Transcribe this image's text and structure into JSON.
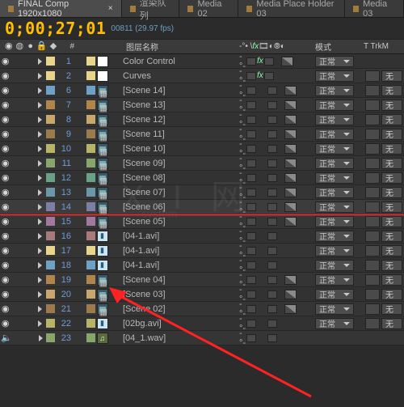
{
  "tabs": [
    {
      "label": "FINAL Comp 1920x1080",
      "active": true
    },
    {
      "label": "渲染队列"
    },
    {
      "label": "Media 02"
    },
    {
      "label": "Media Place Holder 03"
    },
    {
      "label": "Media 03"
    }
  ],
  "timecode": "0;00;27;01",
  "timecode_sub": "00811 (29.97 fps)",
  "headers": {
    "num": "#",
    "name": "图层名称",
    "sw": "⁄ fx",
    "mode": "模式",
    "trk": "T  TrkM"
  },
  "mode_normal": "正常",
  "none": "无",
  "colors": {
    "p1": "#e9d48c",
    "p2": "#6fa1c6",
    "p3": "#b0854c",
    "p4": "#c8a76c",
    "p5": "#9d7a4e",
    "p6": "#b7b367",
    "p7": "#87a66c",
    "p8": "#6aa087",
    "p9": "#6b97a8",
    "p10": "#7c7fa3",
    "p11": "#a2799e",
    "p12": "#a87a7a"
  },
  "layers": [
    {
      "n": 1,
      "sw": "p1",
      "type": "solid",
      "name": "Color Control",
      "fx": true,
      "half": true,
      "mode": true
    },
    {
      "n": 2,
      "sw": "p1",
      "type": "solid",
      "name": "Curves",
      "fx": true,
      "half": false,
      "mode": true,
      "none": true
    },
    {
      "n": 6,
      "sw": "p2",
      "type": "comp",
      "name": "[Scene 14]",
      "half": true,
      "mode": true,
      "none": true
    },
    {
      "n": 7,
      "sw": "p3",
      "type": "comp",
      "name": "[Scene 13]",
      "half": true,
      "mode": true,
      "none": true
    },
    {
      "n": 8,
      "sw": "p4",
      "type": "comp",
      "name": "[Scene 12]",
      "half": true,
      "mode": true,
      "none": true
    },
    {
      "n": 9,
      "sw": "p5",
      "type": "comp",
      "name": "[Scene 11]",
      "half": true,
      "mode": true,
      "none": true
    },
    {
      "n": 10,
      "sw": "p6",
      "type": "comp",
      "name": "[Scene 10]",
      "half": true,
      "mode": true,
      "none": true
    },
    {
      "n": 11,
      "sw": "p7",
      "type": "comp",
      "name": "[Scene 09]",
      "half": true,
      "mode": true,
      "none": true
    },
    {
      "n": 12,
      "sw": "p8",
      "type": "comp",
      "name": "[Scene 08]",
      "half": true,
      "mode": true,
      "none": true
    },
    {
      "n": 13,
      "sw": "p9",
      "type": "comp",
      "name": "[Scene 07]",
      "half": true,
      "mode": true,
      "none": true
    },
    {
      "n": 14,
      "sw": "p10",
      "type": "comp",
      "name": "[Scene 06]",
      "half": true,
      "mode": true,
      "none": true,
      "hl": true
    },
    {
      "n": 15,
      "sw": "p11",
      "type": "comp",
      "name": "[Scene 05]",
      "half": true,
      "mode": true,
      "none": true
    },
    {
      "n": 16,
      "sw": "p12",
      "type": "video",
      "name": "[04-1.avi]",
      "half": false,
      "mode": true,
      "none": true
    },
    {
      "n": 17,
      "sw": "p1",
      "type": "video",
      "name": "[04-1.avi]",
      "half": false,
      "mode": true,
      "none": true
    },
    {
      "n": 18,
      "sw": "p2",
      "type": "video",
      "name": "[04-1.avi]",
      "half": false,
      "mode": true,
      "none": true
    },
    {
      "n": 19,
      "sw": "p3",
      "type": "comp",
      "name": "[Scene 04]",
      "half": true,
      "mode": true,
      "none": true
    },
    {
      "n": 20,
      "sw": "p4",
      "type": "comp",
      "name": "[Scene 03]",
      "half": true,
      "mode": true,
      "none": true
    },
    {
      "n": 21,
      "sw": "p5",
      "type": "comp",
      "name": "[Scene 02]",
      "half": true,
      "mode": true,
      "none": true
    },
    {
      "n": 22,
      "sw": "p6",
      "type": "video",
      "name": "[02bg.avi]",
      "half": false,
      "mode": true,
      "none": true
    },
    {
      "n": 23,
      "sw": "p7",
      "type": "audio",
      "name": "[04_1.wav]",
      "half": false,
      "mode": false,
      "audio": true
    }
  ]
}
